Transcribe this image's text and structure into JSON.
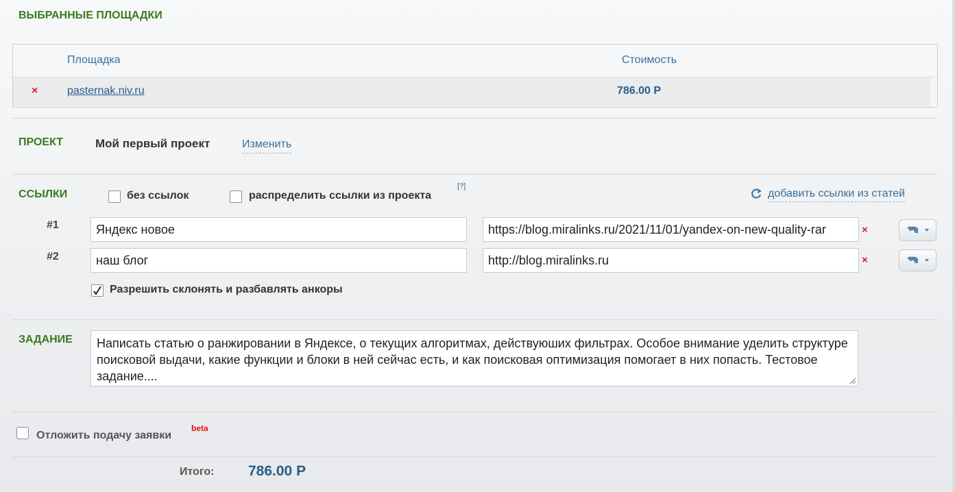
{
  "selected": {
    "title": "ВЫБРАННЫЕ ПЛОЩАДКИ",
    "col_site": "Площадка",
    "col_cost": "Стоимость",
    "rows": [
      {
        "site": "pasternak.niv.ru",
        "cost": "786.00 Р",
        "remove": "×"
      }
    ]
  },
  "project": {
    "title": "ПРОЕКТ",
    "name": "Мой первый проект",
    "change": "Изменить"
  },
  "links": {
    "title": "ССЫЛКИ",
    "no_links": {
      "label": "без ссылок",
      "checked": false
    },
    "distribute": {
      "label": "распределить ссылки из проекта",
      "checked": false
    },
    "help": "[?]",
    "add_from_articles": "добавить ссылки из статей",
    "items": [
      {
        "num": "#1",
        "anchor": "Яндекс новое",
        "url": "https://blog.miralinks.ru/2021/11/01/yandex-on-new-quality-rar",
        "remove": "×"
      },
      {
        "num": "#2",
        "anchor": "наш блог",
        "url": "http://blog.miralinks.ru",
        "remove": "×"
      }
    ],
    "allow_inflect": {
      "label": "Разрешить склонять и разбавлять анкоры",
      "checked": true
    }
  },
  "task": {
    "title": "ЗАДАНИЕ",
    "text": "Написать статью о ранжировании в Яндексе, о текущих алгоритмах, действуюших фильтрах. Особое внимание уделить структуре поисковой выдачи, какие функции и блоки в ней сейчас есть, и как поисковая оптимизация помогает в них попасть. Тестовое задание...."
  },
  "postpone": {
    "label": "Отложить подачу заявки",
    "badge": "beta",
    "checked": false
  },
  "total": {
    "label": "Итого:",
    "value": "786.00 Р"
  },
  "colors": {
    "section_title": "#3b7a1e",
    "link": "#3a6e98",
    "price": "#2b5d8c",
    "danger": "#d62020"
  }
}
